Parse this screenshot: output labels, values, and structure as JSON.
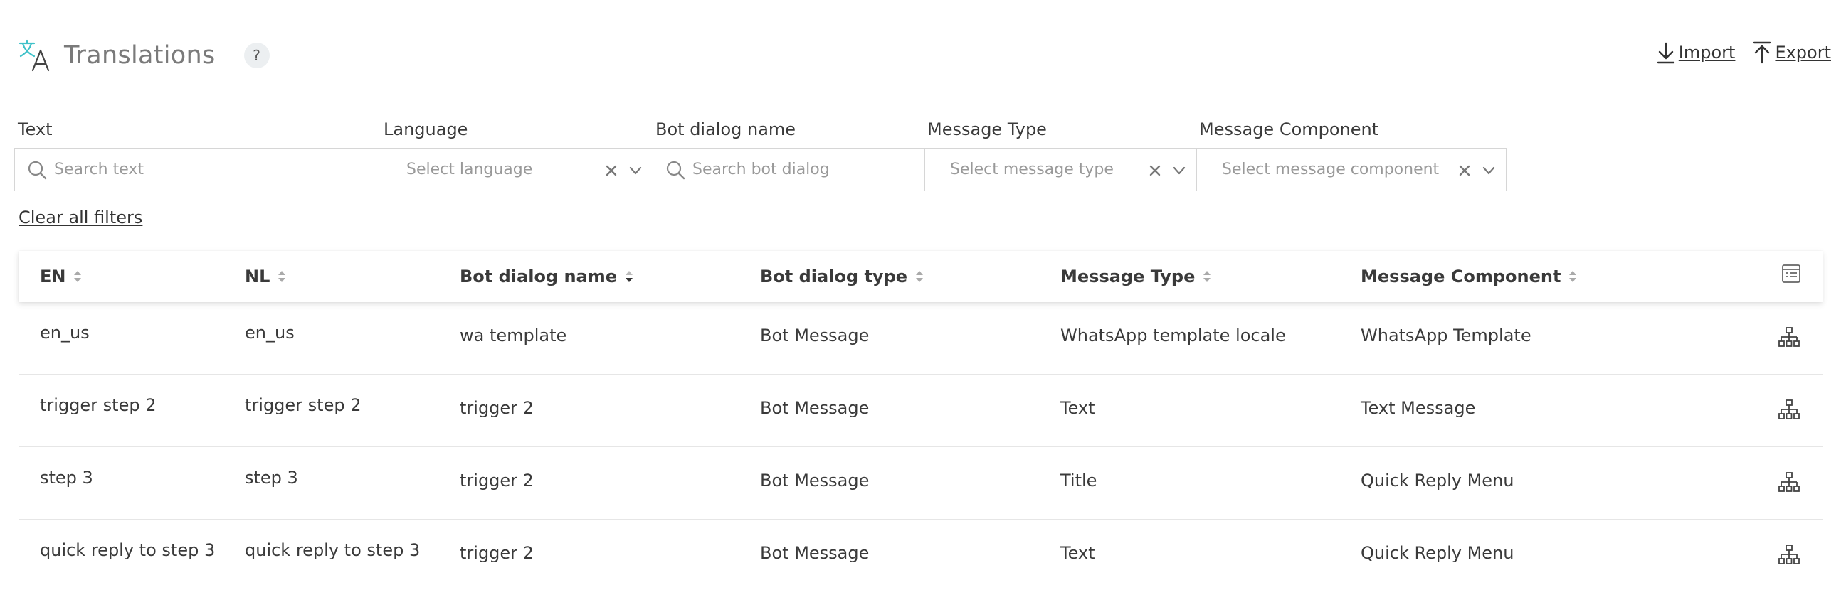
{
  "header": {
    "title": "Translations",
    "help_label": "?",
    "icon": "translate-icon",
    "actions": {
      "import_label": "Import",
      "export_label": "Export"
    }
  },
  "filters": {
    "text": {
      "label": "Text",
      "placeholder": "Search text"
    },
    "language": {
      "label": "Language",
      "placeholder": "Select language"
    },
    "bot_dialog": {
      "label": "Bot dialog name",
      "placeholder": "Search bot dialog"
    },
    "message_type": {
      "label": "Message Type",
      "placeholder": "Select message type"
    },
    "message_component": {
      "label": "Message Component",
      "placeholder": "Select message component"
    },
    "clear_all": "Clear all filters"
  },
  "table": {
    "columns": [
      "EN",
      "NL",
      "Bot dialog name",
      "Bot dialog type",
      "Message Type",
      "Message Component"
    ],
    "sorted_column": "Bot dialog name",
    "rows": [
      [
        "en_us",
        "en_us",
        "wa template",
        "Bot Message",
        "WhatsApp template locale",
        "WhatsApp Template"
      ],
      [
        "trigger step 2",
        "trigger step 2",
        "trigger 2",
        "Bot Message",
        "Text",
        "Text Message"
      ],
      [
        "step 3",
        "step 3",
        "trigger 2",
        "Bot Message",
        "Title",
        "Quick Reply Menu"
      ],
      [
        "quick reply to step 3",
        "quick reply to step 3",
        "trigger 2",
        "Bot Message",
        "Text",
        "Quick Reply Menu"
      ]
    ]
  },
  "colors": {
    "accent_icon": "#3ec1c9",
    "text": "#3a3a3a",
    "muted": "#999999",
    "border": "#d6d6d6"
  }
}
